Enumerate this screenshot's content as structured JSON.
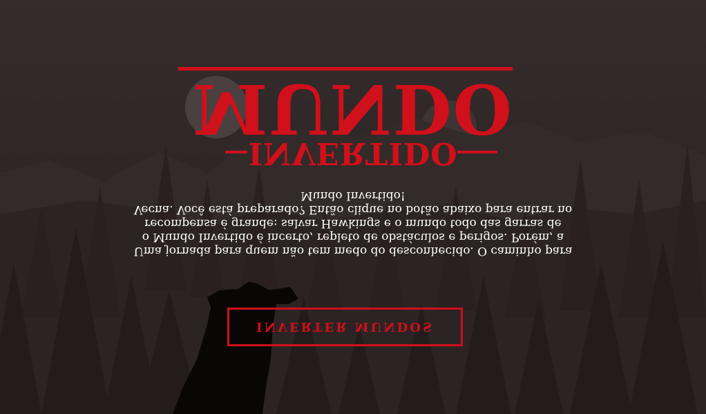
{
  "hero": {
    "title_small": "INVERTIDO",
    "title_large": "MUNDO",
    "description": "Uma jornada para quem não tem medo do desconhecido. O caminho para o Mundo Invertido é incerto, repleto de obstáculos e perigos. Porém, a recompensa é grande: salvar Hawkings e o mundo todo das garras de Vecna. Você está preparado? Então clique no botão abaixo para entrar no Mundo Invertido!",
    "cta_label": "INVERTER MUNDOS"
  },
  "colors": {
    "accent": "#d0101a",
    "background": "#2e2626",
    "text": "#ffffff"
  },
  "state": {
    "orientation": "inverted"
  }
}
